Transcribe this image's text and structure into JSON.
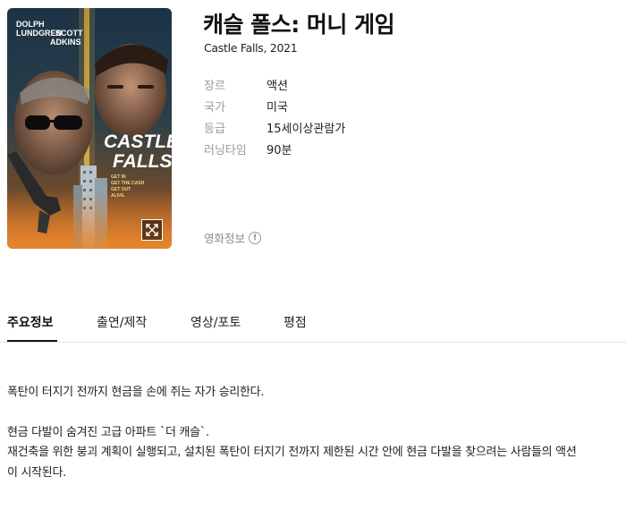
{
  "movie": {
    "title": "캐슬 폴스: 머니 게임",
    "subtitle": "Castle Falls, 2021",
    "details": [
      {
        "label": "장르",
        "value": "액션"
      },
      {
        "label": "국가",
        "value": "미국"
      },
      {
        "label": "등급",
        "value": "15세이상관람가"
      },
      {
        "label": "러닝타임",
        "value": "90분"
      }
    ],
    "info_link": "영화정보"
  },
  "poster": {
    "actor1_first": "DOLPH",
    "actor1_last": "LUNDGREN",
    "actor2_first": "SCOTT",
    "actor2_last": "ADKINS",
    "title_line1": "CASTLE",
    "title_line2": "FALLS",
    "tagline1": "GET IN",
    "tagline2": "GET THE CASH",
    "tagline3": "GET OUT",
    "tagline4": "ALIVE."
  },
  "tabs": [
    {
      "label": "주요정보",
      "active": true
    },
    {
      "label": "출연/제작",
      "active": false
    },
    {
      "label": "영상/포토",
      "active": false
    },
    {
      "label": "평점",
      "active": false
    }
  ],
  "synopsis": {
    "line1": "폭탄이 터지기 전까지 현금을 손에 쥐는 자가 승리한다.",
    "line2": "현금 다발이 숨겨진 고급 아파트 `더 캐슬`.",
    "line3": "재건축을 위한 붕괴 계획이 실행되고, 설치된 폭탄이 터지기 전까지 제한된 시간 안에 현금 다발을 찾으려는 사람들의 액션",
    "line4": "이 시작된다."
  }
}
